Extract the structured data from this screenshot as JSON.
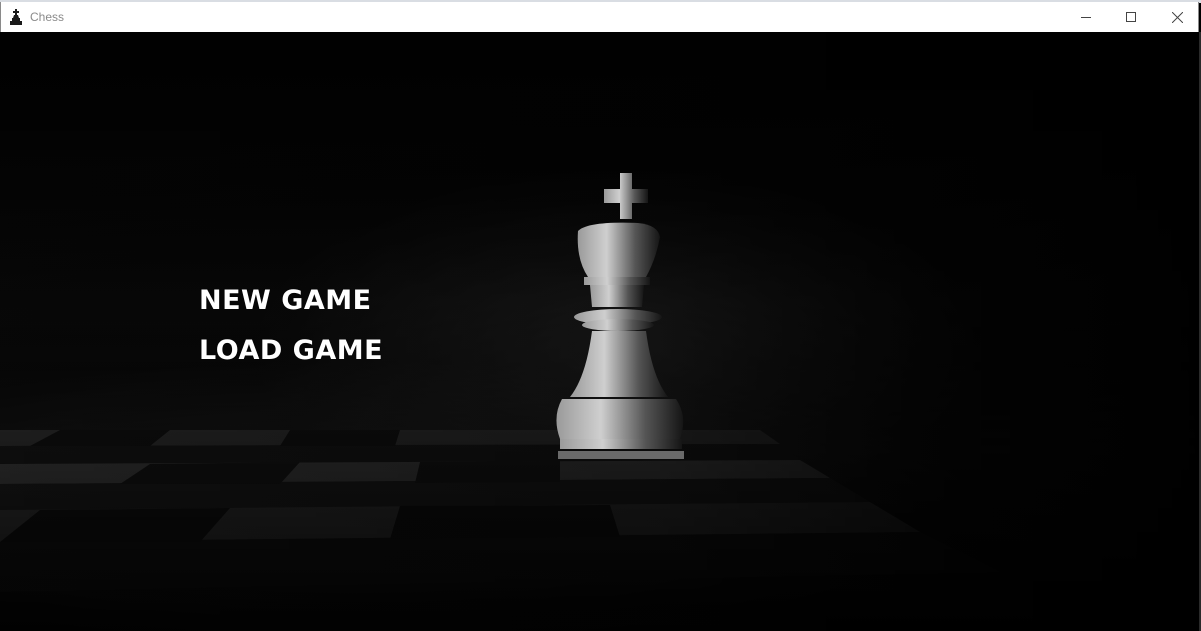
{
  "window": {
    "title": "Chess",
    "icon": "chess-piece-icon",
    "controls": {
      "minimize": "minimize-icon",
      "maximize": "maximize-icon",
      "close": "close-icon"
    }
  },
  "menu": {
    "new_game": "NEW GAME",
    "load_game": "LOAD GAME"
  },
  "colors": {
    "background": "#000000",
    "menu_text": "#ffffff",
    "titlebar": "#ffffff",
    "title_text": "#8a8a8a"
  }
}
